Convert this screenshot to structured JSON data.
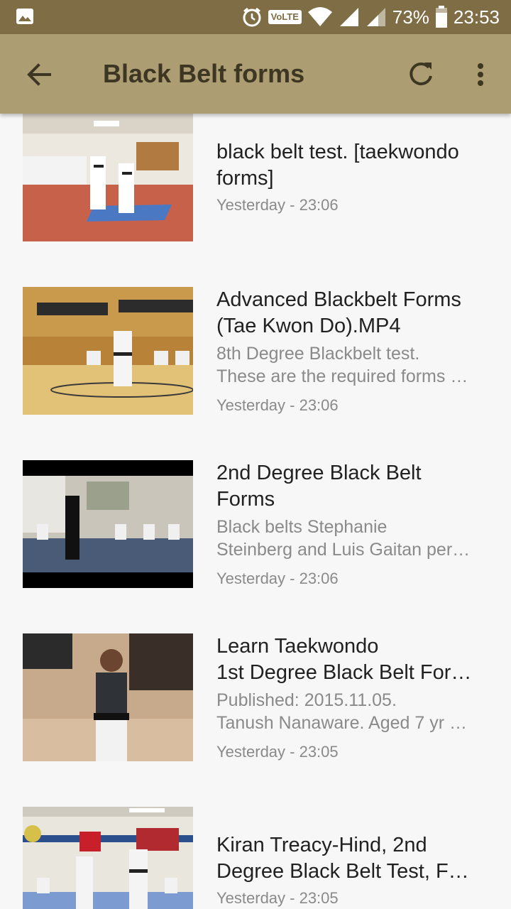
{
  "status_bar": {
    "volte": "VoLTE",
    "battery": "73%",
    "time": "23:53"
  },
  "app_bar": {
    "title": "Black Belt forms",
    "back_icon": "arrow-back-icon",
    "refresh_icon": "refresh-icon",
    "more_icon": "more-vert-icon"
  },
  "videos": [
    {
      "title_lines": [
        "black belt test. [taekwondo",
        "forms]"
      ],
      "desc_lines": [],
      "time": "Yesterday - 23:06"
    },
    {
      "title_lines": [
        "Advanced Blackbelt Forms",
        "(Tae Kwon Do).MP4"
      ],
      "desc_lines": [
        "8th Degree Blackbelt test.",
        "These are the required forms …"
      ],
      "time": "Yesterday - 23:06"
    },
    {
      "title_lines": [
        "2nd Degree Black Belt",
        "Forms"
      ],
      "desc_lines": [
        "Black belts Stephanie",
        "Steinberg and Luis Gaitan per…"
      ],
      "time": "Yesterday - 23:06"
    },
    {
      "title_lines": [
        "Learn Taekwondo",
        "1st Degree Black Belt For…"
      ],
      "desc_lines": [
        "Published: 2015.11.05.",
        "Tanush Nanaware. Aged 7 yr …"
      ],
      "time": "Yesterday - 23:05"
    },
    {
      "title_lines": [
        "Kiran Treacy-Hind, 2nd",
        "Degree Black Belt Test, F…"
      ],
      "desc_lines": [],
      "time": "Yesterday - 23:05"
    }
  ]
}
